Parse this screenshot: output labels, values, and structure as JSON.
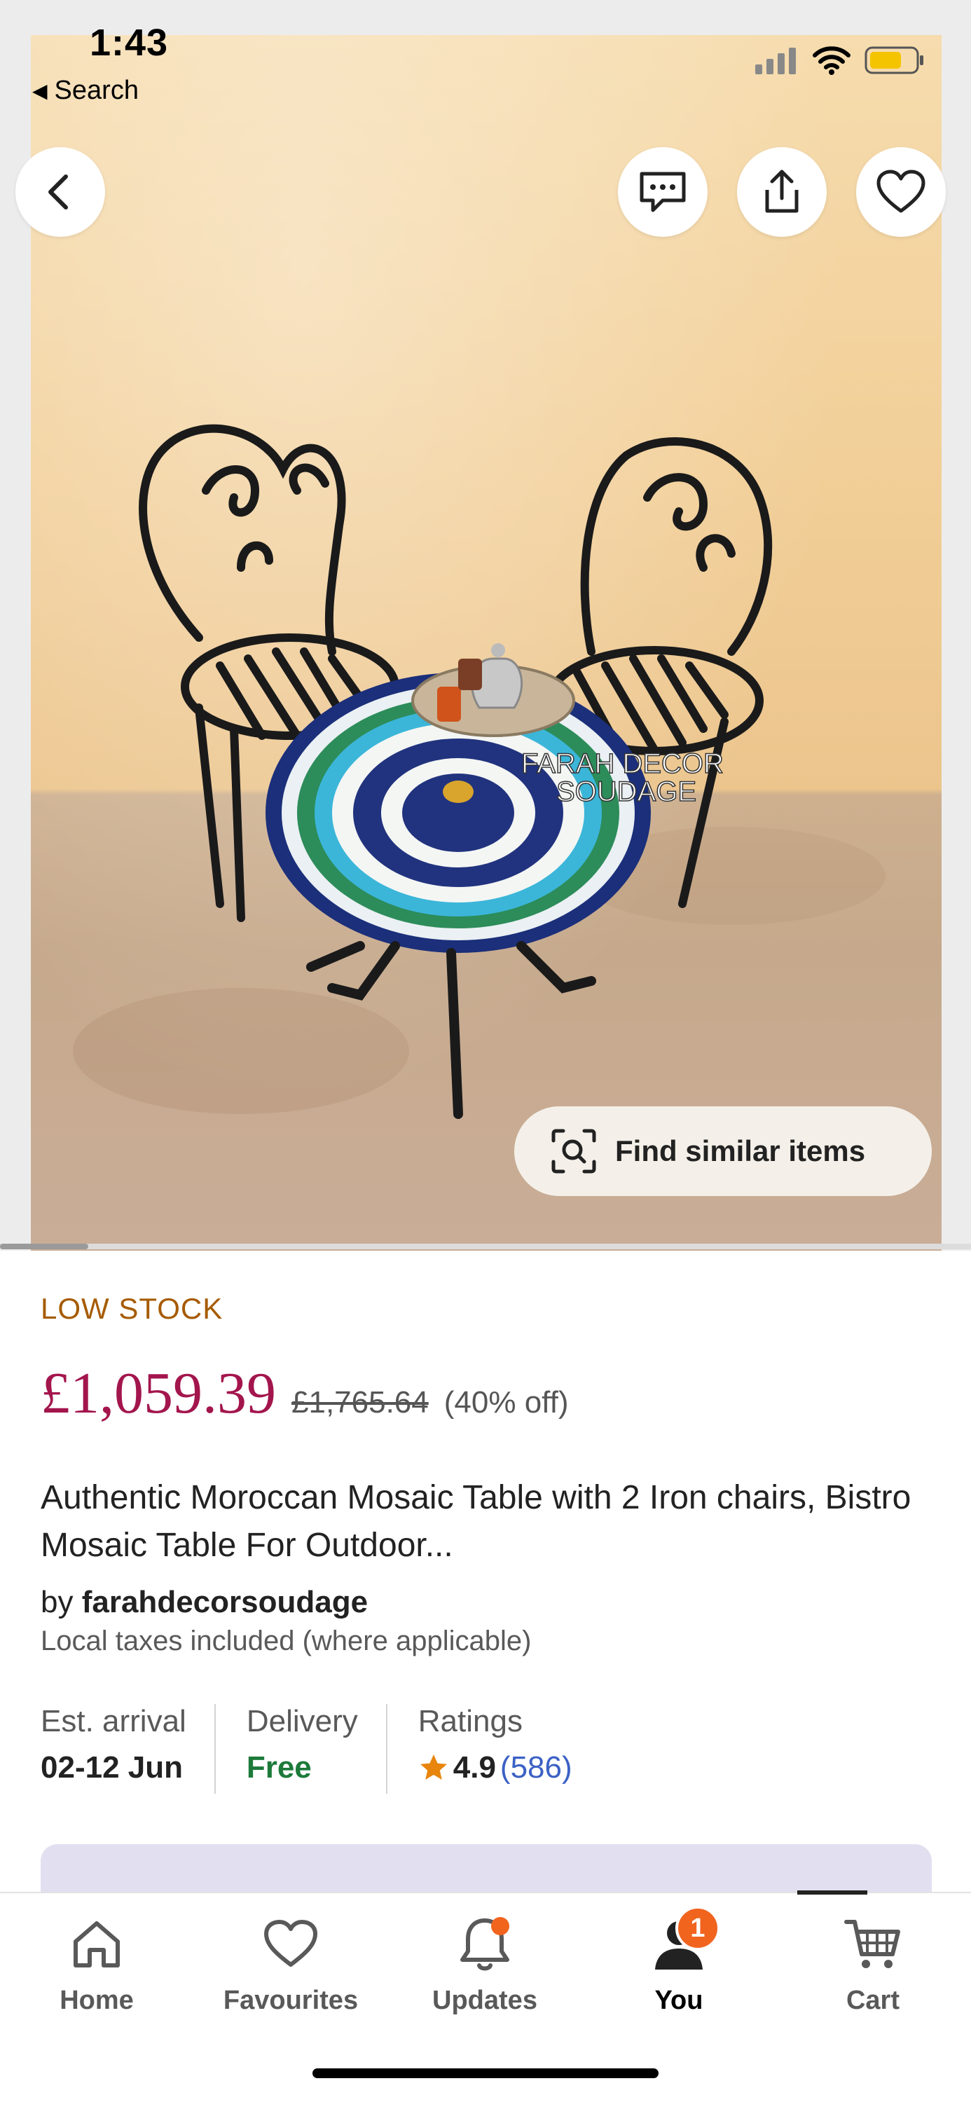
{
  "status_bar": {
    "time": "1:43",
    "back_app_label": "Search"
  },
  "hero": {
    "image_watermark_line1": "FARAH DECOR",
    "image_watermark_line2": "SOUDAGE",
    "find_similar_label": "Find similar items",
    "buttons": [
      "back-arrow-icon",
      "message-icon",
      "share-icon",
      "heart-icon"
    ]
  },
  "product": {
    "stock_label": "LOW STOCK",
    "price": "£1,059.39",
    "original_price": "£1,765.64",
    "discount": "(40% off)",
    "title": "Authentic Moroccan Mosaic Table with 2 Iron chairs, Bistro Mosaic Table For Outdoor...",
    "seller_prefix": "by",
    "seller_name": "farahdecorsoudage",
    "tax_note": "Local taxes included (where applicable)"
  },
  "stats": {
    "arrival_label": "Est. arrival",
    "arrival_value": "02-12 Jun",
    "delivery_label": "Delivery",
    "delivery_value": "Free",
    "ratings_label": "Ratings",
    "rating_value": "4.9",
    "rating_count": "(586)"
  },
  "tabbar": {
    "tabs": [
      {
        "label": "Home",
        "icon": "home-icon"
      },
      {
        "label": "Favourites",
        "icon": "heart-icon"
      },
      {
        "label": "Updates",
        "icon": "bell-icon"
      },
      {
        "label": "You",
        "icon": "person-icon",
        "badge": "1"
      },
      {
        "label": "Cart",
        "icon": "cart-icon"
      }
    ],
    "active": "You"
  },
  "colors": {
    "price": "#a3154d",
    "low_stock": "#a65b00",
    "free": "#1d7a3a",
    "rating_count": "#3b61c4",
    "badge": "#f1641e",
    "star": "#e8850c"
  }
}
